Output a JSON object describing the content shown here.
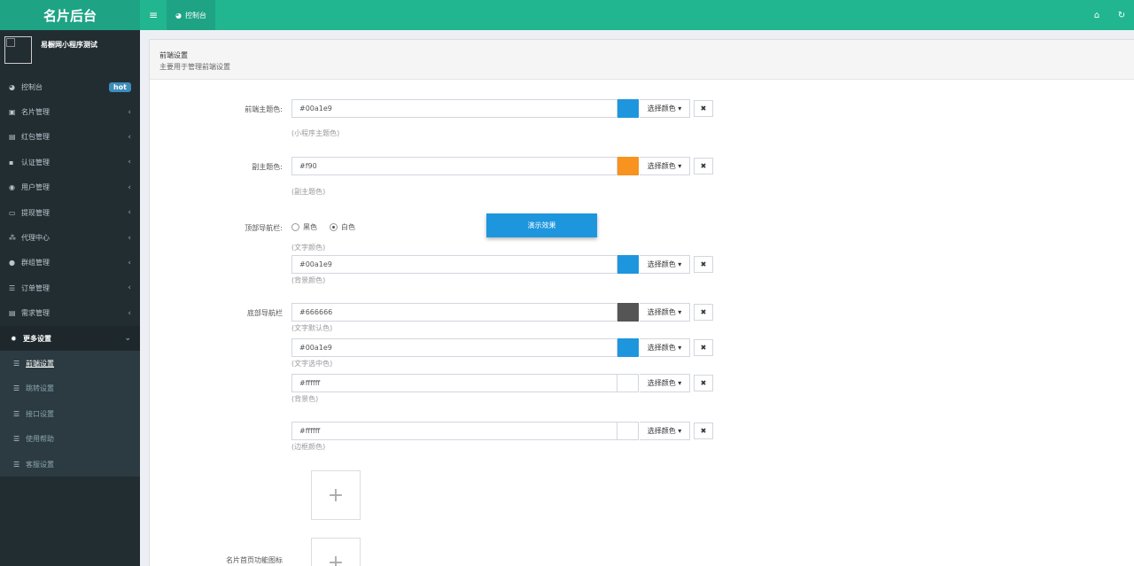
{
  "header": {
    "logo": "名片后台",
    "toggle_icon": "menu-icon",
    "tab_label": "控制台",
    "colors": {
      "bar": "#21b68f",
      "logo_bg": "#1ea385"
    }
  },
  "sidebar": {
    "user_name": "易橱网小程序测试",
    "items": [
      {
        "label": "控制台",
        "icon": "dashboard-icon",
        "badge": "hot"
      },
      {
        "label": "名片管理",
        "icon": "card-icon"
      },
      {
        "label": "红包管理",
        "icon": "redpacket-icon"
      },
      {
        "label": "认证管理",
        "icon": "verify-icon"
      },
      {
        "label": "用户管理",
        "icon": "user-icon"
      },
      {
        "label": "提现管理",
        "icon": "money-icon"
      },
      {
        "label": "代理中心",
        "icon": "sitemap-icon"
      },
      {
        "label": "群组管理",
        "icon": "group-icon"
      },
      {
        "label": "订单管理",
        "icon": "list-icon"
      },
      {
        "label": "需求管理",
        "icon": "list-alt-icon"
      },
      {
        "label": "更多设置",
        "icon": "gear-icon"
      }
    ],
    "submenu": [
      {
        "label": "前端设置",
        "active": true
      },
      {
        "label": "跳转设置"
      },
      {
        "label": "接口设置"
      },
      {
        "label": "使用帮助"
      },
      {
        "label": "客服设置"
      }
    ]
  },
  "box": {
    "title": "前端设置",
    "subtitle": "主要用于管理前端设置"
  },
  "form": {
    "pick_label": "选择颜色",
    "clear_label": "✖",
    "main_color": {
      "label": "前端主题色:",
      "value": "#00a1e9",
      "swatch": "#1e96de",
      "help": "(小程序主题色)"
    },
    "sub_color": {
      "label": "副主题色:",
      "value": "#f90",
      "swatch": "#f7931e",
      "help": "(副主题色)"
    },
    "top_nav": {
      "label": "顶部导航栏:",
      "options": [
        "黑色",
        "白色"
      ],
      "selected": "白色",
      "text_help": "(文字颜色)",
      "bg_value": "#00a1e9",
      "bg_swatch": "#1e96de",
      "bg_help": "(背景颜色)"
    },
    "demo_button": "演示效果",
    "bottom_nav": {
      "label": "底部导航栏",
      "default_value": "#666666",
      "default_swatch": "#555555",
      "default_help": "(文字默认色)",
      "selected_value": "#00a1e9",
      "selected_swatch": "#1e96de",
      "selected_help": "(文字选中色)",
      "bg_value": "#ffffff",
      "bg_swatch": "#ffffff",
      "bg_help": "(背景色)",
      "border_value": "#ffffff",
      "border_swatch": "#ffffff",
      "border_help": "(边框颜色)"
    },
    "icon_label": "名片首页功能图标",
    "upload_glyph": "+"
  }
}
